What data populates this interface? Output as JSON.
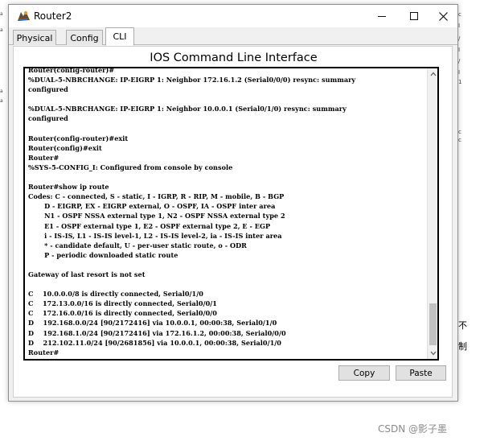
{
  "window": {
    "title": "Router2",
    "controls": {
      "minimize": "minimize",
      "maximize": "maximize",
      "close": "close"
    }
  },
  "tabs": [
    {
      "label": "Physical"
    },
    {
      "label": "Config"
    },
    {
      "label": "CLI",
      "active": true
    }
  ],
  "cli": {
    "heading": "IOS Command Line Interface",
    "lines": [
      "Router(config-router)#",
      "%DUAL-5-NBRCHANGE: IP-EIGRP 1: Neighbor 172.16.1.2 (Serial0/0/0) resync: summary",
      "configured",
      "",
      "%DUAL-5-NBRCHANGE: IP-EIGRP 1: Neighbor 10.0.0.1 (Serial0/1/0) resync: summary",
      "configured",
      "",
      "Router(config-router)#exit",
      "Router(config)#exit",
      "Router#",
      "%SYS-5-CONFIG_I: Configured from console by console",
      "",
      "Router#show ip route",
      "Codes: C - connected, S - static, I - IGRP, R - RIP, M - mobile, B - BGP",
      "       D - EIGRP, EX - EIGRP external, O - OSPF, IA - OSPF inter area",
      "       N1 - OSPF NSSA external type 1, N2 - OSPF NSSA external type 2",
      "       E1 - OSPF external type 1, E2 - OSPF external type 2, E - EGP",
      "       i - IS-IS, L1 - IS-IS level-1, L2 - IS-IS level-2, ia - IS-IS inter area",
      "       * - candidate default, U - per-user static route, o - ODR",
      "       P - periodic downloaded static route",
      "",
      "Gateway of last resort is not set",
      "",
      "C    10.0.0.0/8 is directly connected, Serial0/1/0",
      "C    172.13.0.0/16 is directly connected, Serial0/0/1",
      "C    172.16.0.0/16 is directly connected, Serial0/0/0",
      "D    192.168.0.0/24 [90/2172416] via 10.0.0.1, 00:00:38, Serial0/1/0",
      "D    192.168.1.0/24 [90/2172416] via 172.16.1.2, 00:00:38, Serial0/0/0",
      "D    212.102.11.0/24 [90/2681856] via 10.0.0.1, 00:00:38, Serial0/1/0",
      "Router#"
    ],
    "scroll_position": 0.88
  },
  "buttons": {
    "copy": "Copy",
    "paste": "Paste"
  },
  "watermark": "CSDN @影子墨",
  "colors": {
    "window_bg": "#f0f0f0",
    "terminal_border": "#000000",
    "text": "#000000"
  }
}
